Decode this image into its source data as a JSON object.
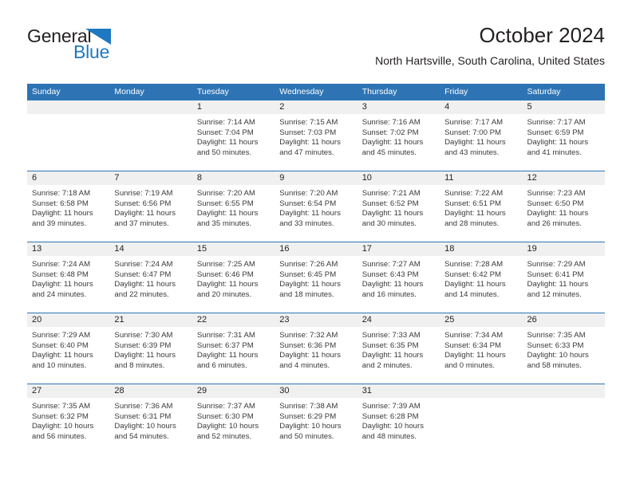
{
  "logo": {
    "word_one": "General",
    "word_two": "Blue",
    "accent_color": "#1f78c1",
    "text_color": "#231f20",
    "triangle_icon": "blue-triangle-icon"
  },
  "header": {
    "title": "October 2024",
    "subtitle": "North Hartsville, South Carolina, United States"
  },
  "theme": {
    "header_row_bg": "#2e74b5",
    "header_row_text": "#ffffff",
    "daynum_band_bg": "#f0f0f0",
    "cell_border": "#2e74b5",
    "body_text": "#3a3a3a"
  },
  "weekdays": [
    "Sunday",
    "Monday",
    "Tuesday",
    "Wednesday",
    "Thursday",
    "Friday",
    "Saturday"
  ],
  "weeks": [
    [
      {
        "day": "",
        "lines": []
      },
      {
        "day": "",
        "lines": []
      },
      {
        "day": "1",
        "lines": [
          "Sunrise: 7:14 AM",
          "Sunset: 7:04 PM",
          "Daylight: 11 hours",
          "and 50 minutes."
        ]
      },
      {
        "day": "2",
        "lines": [
          "Sunrise: 7:15 AM",
          "Sunset: 7:03 PM",
          "Daylight: 11 hours",
          "and 47 minutes."
        ]
      },
      {
        "day": "3",
        "lines": [
          "Sunrise: 7:16 AM",
          "Sunset: 7:02 PM",
          "Daylight: 11 hours",
          "and 45 minutes."
        ]
      },
      {
        "day": "4",
        "lines": [
          "Sunrise: 7:17 AM",
          "Sunset: 7:00 PM",
          "Daylight: 11 hours",
          "and 43 minutes."
        ]
      },
      {
        "day": "5",
        "lines": [
          "Sunrise: 7:17 AM",
          "Sunset: 6:59 PM",
          "Daylight: 11 hours",
          "and 41 minutes."
        ]
      }
    ],
    [
      {
        "day": "6",
        "lines": [
          "Sunrise: 7:18 AM",
          "Sunset: 6:58 PM",
          "Daylight: 11 hours",
          "and 39 minutes."
        ]
      },
      {
        "day": "7",
        "lines": [
          "Sunrise: 7:19 AM",
          "Sunset: 6:56 PM",
          "Daylight: 11 hours",
          "and 37 minutes."
        ]
      },
      {
        "day": "8",
        "lines": [
          "Sunrise: 7:20 AM",
          "Sunset: 6:55 PM",
          "Daylight: 11 hours",
          "and 35 minutes."
        ]
      },
      {
        "day": "9",
        "lines": [
          "Sunrise: 7:20 AM",
          "Sunset: 6:54 PM",
          "Daylight: 11 hours",
          "and 33 minutes."
        ]
      },
      {
        "day": "10",
        "lines": [
          "Sunrise: 7:21 AM",
          "Sunset: 6:52 PM",
          "Daylight: 11 hours",
          "and 30 minutes."
        ]
      },
      {
        "day": "11",
        "lines": [
          "Sunrise: 7:22 AM",
          "Sunset: 6:51 PM",
          "Daylight: 11 hours",
          "and 28 minutes."
        ]
      },
      {
        "day": "12",
        "lines": [
          "Sunrise: 7:23 AM",
          "Sunset: 6:50 PM",
          "Daylight: 11 hours",
          "and 26 minutes."
        ]
      }
    ],
    [
      {
        "day": "13",
        "lines": [
          "Sunrise: 7:24 AM",
          "Sunset: 6:48 PM",
          "Daylight: 11 hours",
          "and 24 minutes."
        ]
      },
      {
        "day": "14",
        "lines": [
          "Sunrise: 7:24 AM",
          "Sunset: 6:47 PM",
          "Daylight: 11 hours",
          "and 22 minutes."
        ]
      },
      {
        "day": "15",
        "lines": [
          "Sunrise: 7:25 AM",
          "Sunset: 6:46 PM",
          "Daylight: 11 hours",
          "and 20 minutes."
        ]
      },
      {
        "day": "16",
        "lines": [
          "Sunrise: 7:26 AM",
          "Sunset: 6:45 PM",
          "Daylight: 11 hours",
          "and 18 minutes."
        ]
      },
      {
        "day": "17",
        "lines": [
          "Sunrise: 7:27 AM",
          "Sunset: 6:43 PM",
          "Daylight: 11 hours",
          "and 16 minutes."
        ]
      },
      {
        "day": "18",
        "lines": [
          "Sunrise: 7:28 AM",
          "Sunset: 6:42 PM",
          "Daylight: 11 hours",
          "and 14 minutes."
        ]
      },
      {
        "day": "19",
        "lines": [
          "Sunrise: 7:29 AM",
          "Sunset: 6:41 PM",
          "Daylight: 11 hours",
          "and 12 minutes."
        ]
      }
    ],
    [
      {
        "day": "20",
        "lines": [
          "Sunrise: 7:29 AM",
          "Sunset: 6:40 PM",
          "Daylight: 11 hours",
          "and 10 minutes."
        ]
      },
      {
        "day": "21",
        "lines": [
          "Sunrise: 7:30 AM",
          "Sunset: 6:39 PM",
          "Daylight: 11 hours",
          "and 8 minutes."
        ]
      },
      {
        "day": "22",
        "lines": [
          "Sunrise: 7:31 AM",
          "Sunset: 6:37 PM",
          "Daylight: 11 hours",
          "and 6 minutes."
        ]
      },
      {
        "day": "23",
        "lines": [
          "Sunrise: 7:32 AM",
          "Sunset: 6:36 PM",
          "Daylight: 11 hours",
          "and 4 minutes."
        ]
      },
      {
        "day": "24",
        "lines": [
          "Sunrise: 7:33 AM",
          "Sunset: 6:35 PM",
          "Daylight: 11 hours",
          "and 2 minutes."
        ]
      },
      {
        "day": "25",
        "lines": [
          "Sunrise: 7:34 AM",
          "Sunset: 6:34 PM",
          "Daylight: 11 hours",
          "and 0 minutes."
        ]
      },
      {
        "day": "26",
        "lines": [
          "Sunrise: 7:35 AM",
          "Sunset: 6:33 PM",
          "Daylight: 10 hours",
          "and 58 minutes."
        ]
      }
    ],
    [
      {
        "day": "27",
        "lines": [
          "Sunrise: 7:35 AM",
          "Sunset: 6:32 PM",
          "Daylight: 10 hours",
          "and 56 minutes."
        ]
      },
      {
        "day": "28",
        "lines": [
          "Sunrise: 7:36 AM",
          "Sunset: 6:31 PM",
          "Daylight: 10 hours",
          "and 54 minutes."
        ]
      },
      {
        "day": "29",
        "lines": [
          "Sunrise: 7:37 AM",
          "Sunset: 6:30 PM",
          "Daylight: 10 hours",
          "and 52 minutes."
        ]
      },
      {
        "day": "30",
        "lines": [
          "Sunrise: 7:38 AM",
          "Sunset: 6:29 PM",
          "Daylight: 10 hours",
          "and 50 minutes."
        ]
      },
      {
        "day": "31",
        "lines": [
          "Sunrise: 7:39 AM",
          "Sunset: 6:28 PM",
          "Daylight: 10 hours",
          "and 48 minutes."
        ]
      },
      {
        "day": "",
        "lines": []
      },
      {
        "day": "",
        "lines": []
      }
    ]
  ]
}
